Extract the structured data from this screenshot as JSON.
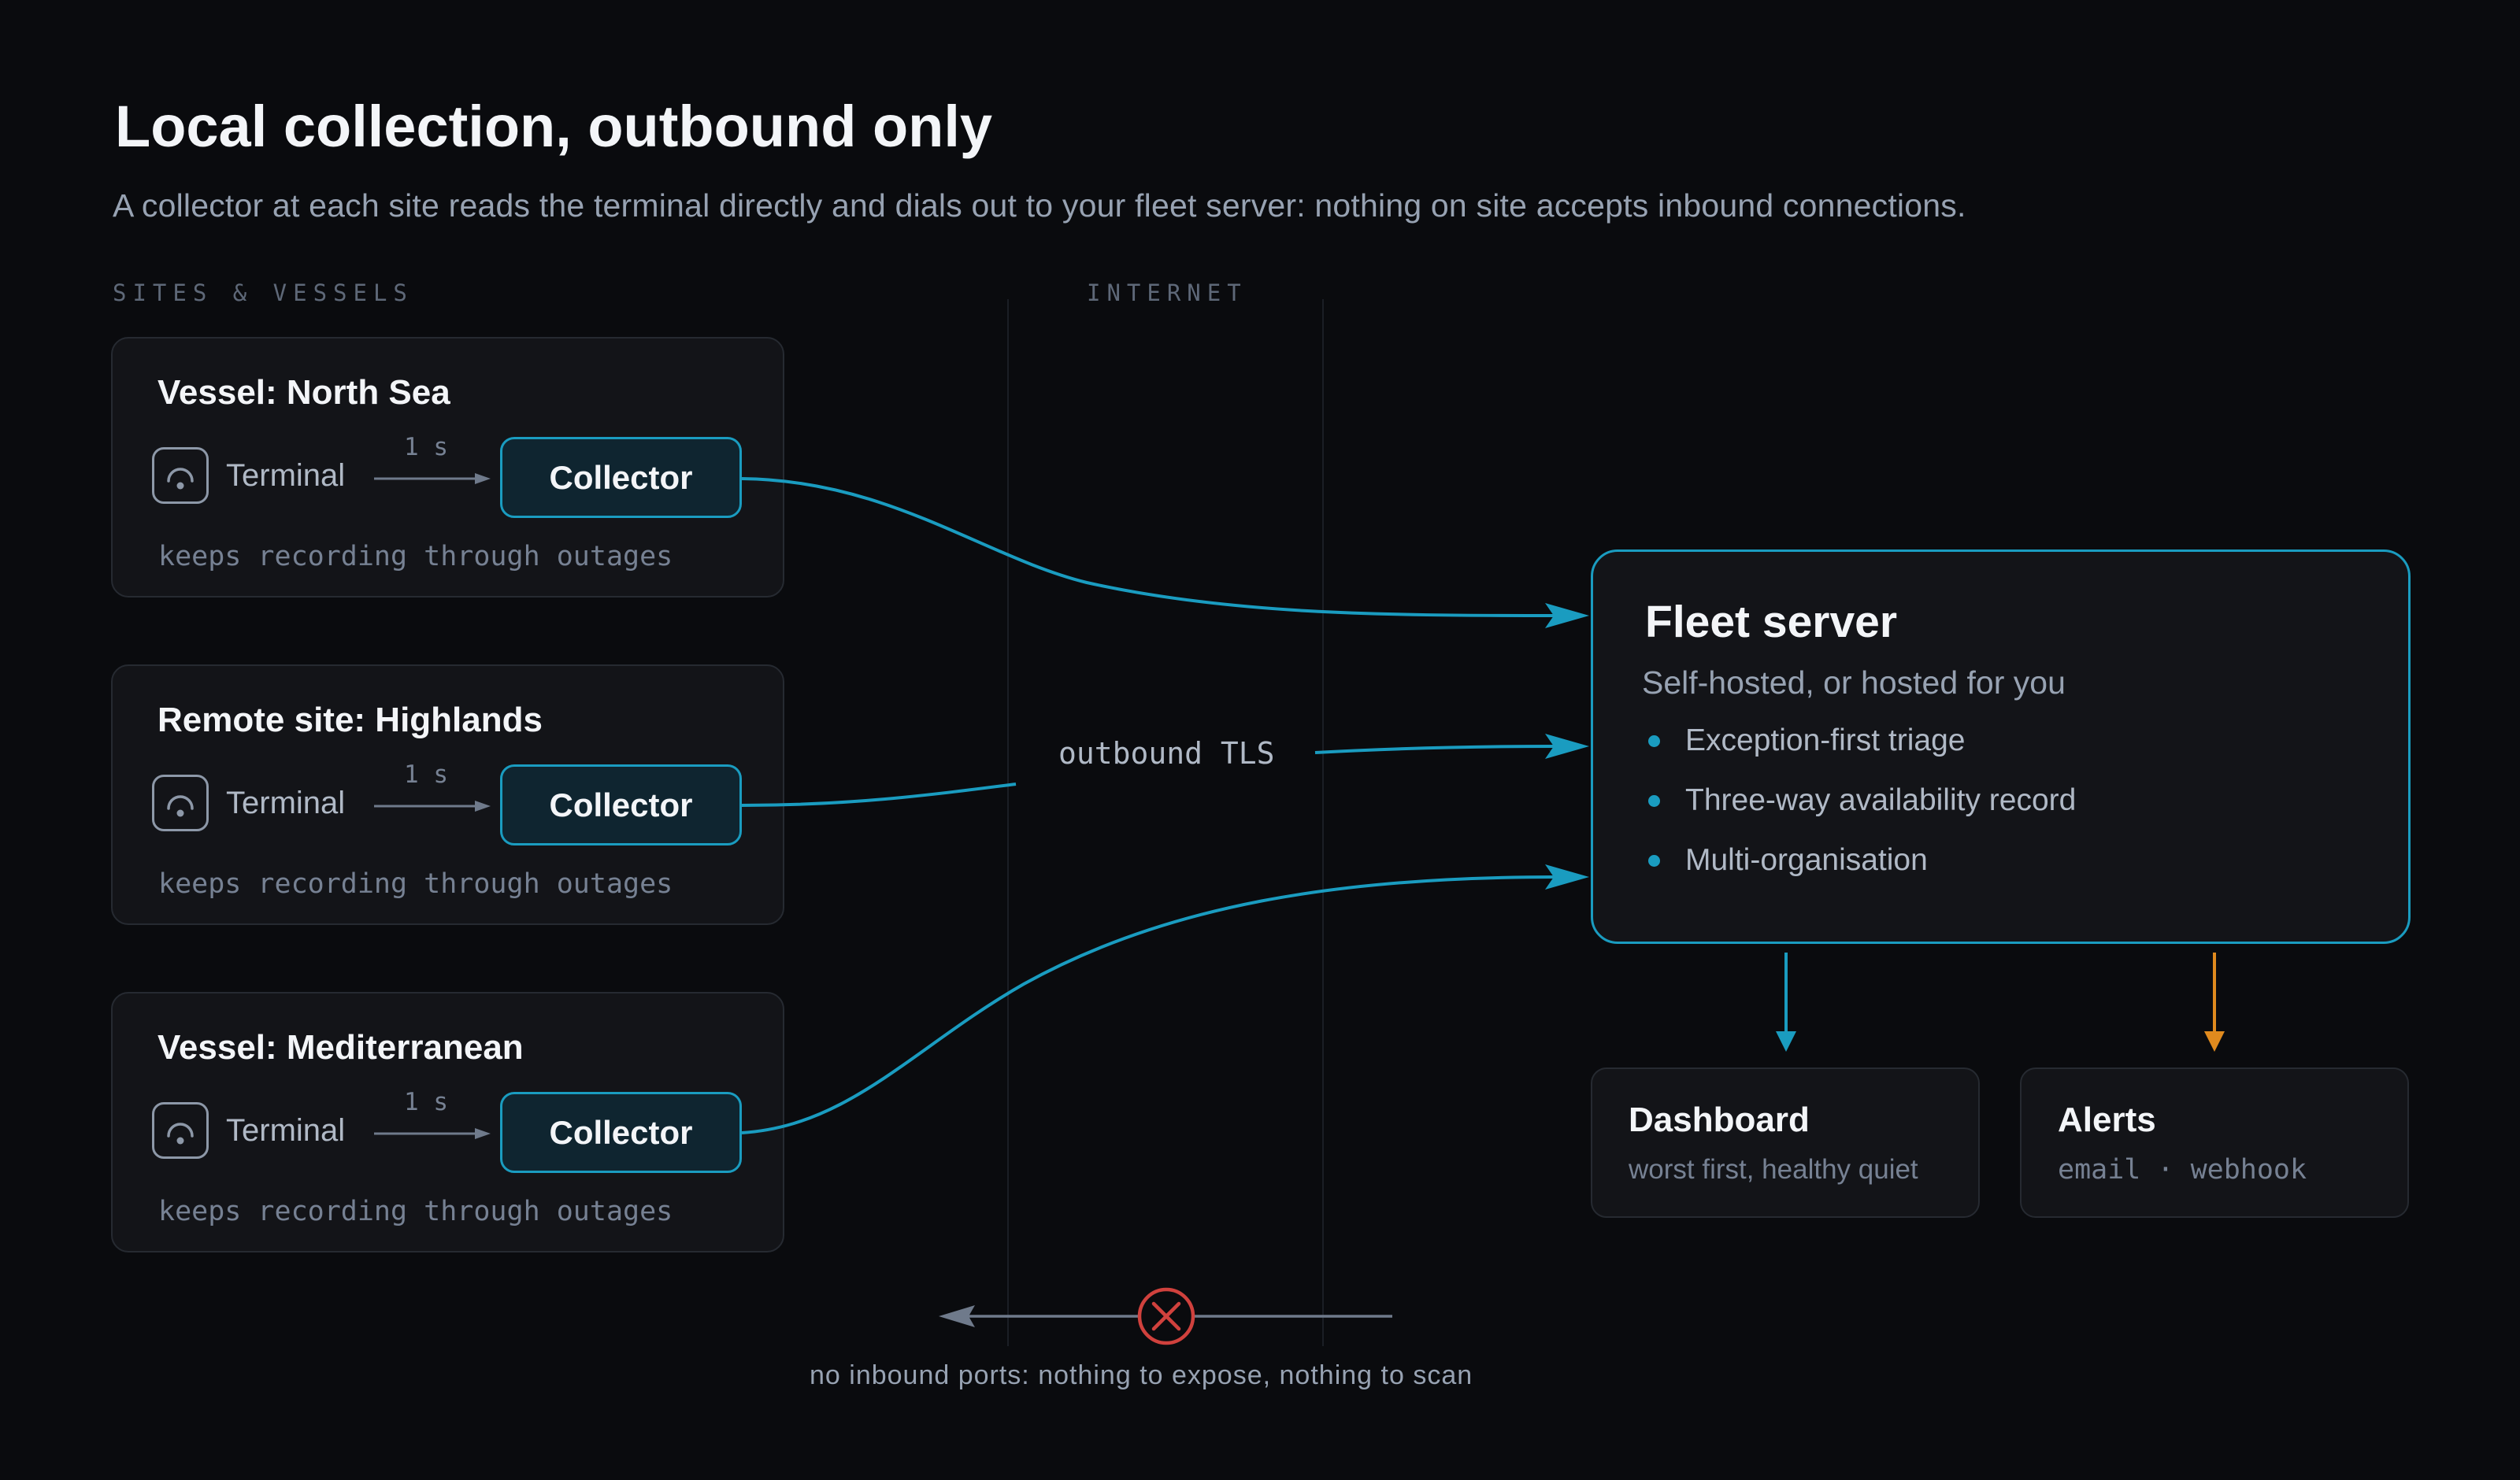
{
  "title": "Local collection, outbound only",
  "subtitle": "A collector at each site reads the terminal directly and dials out to your fleet server: nothing on site accepts inbound connections.",
  "sections": {
    "sites": "SITES & VESSELS",
    "internet": "INTERNET"
  },
  "sites": [
    {
      "name": "Vessel: North Sea",
      "terminal": "Terminal",
      "rate": "1 s",
      "collector": "Collector",
      "note": "keeps recording through outages"
    },
    {
      "name": "Remote site: Highlands",
      "terminal": "Terminal",
      "rate": "1 s",
      "collector": "Collector",
      "note": "keeps recording through outages"
    },
    {
      "name": "Vessel: Mediterranean",
      "terminal": "Terminal",
      "rate": "1 s",
      "collector": "Collector",
      "note": "keeps recording through outages"
    }
  ],
  "link_label": "outbound TLS",
  "fleet": {
    "title": "Fleet server",
    "subtitle": "Self-hosted, or hosted for you",
    "features": [
      "Exception-first triage",
      "Three-way availability record",
      "Multi-organisation"
    ]
  },
  "outputs": {
    "dashboard": {
      "title": "Dashboard",
      "subtitle": "worst first, healthy quiet"
    },
    "alerts": {
      "title": "Alerts",
      "subtitle": "email · webhook"
    }
  },
  "blocked_label": "no inbound ports: nothing to expose, nothing to scan",
  "colors": {
    "accent": "#1a9cc0",
    "alert": "#e08a1e",
    "blocked": "#d0413d",
    "background": "#0a0b0e"
  },
  "icons": {
    "terminal": "terminal-icon",
    "blocked": "blocked-x-icon"
  }
}
